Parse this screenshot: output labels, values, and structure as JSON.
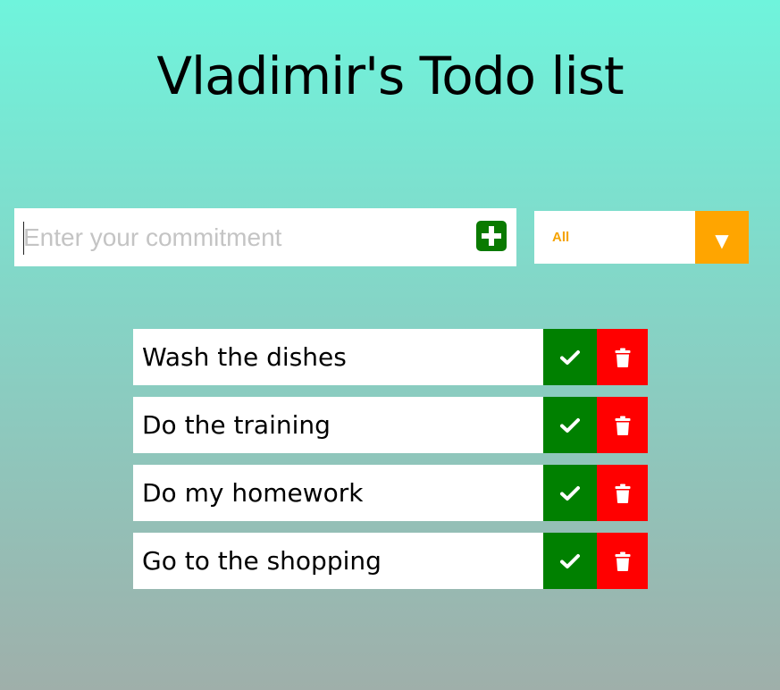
{
  "header": {
    "title": "Vladimir's Todo list"
  },
  "form": {
    "placeholder": "Enter your commitment",
    "value": "",
    "add_icon": "plus-square-icon",
    "filter": {
      "selected": "All",
      "arrow": "▼"
    }
  },
  "todos": [
    {
      "text": "Wash the dishes"
    },
    {
      "text": "Do the training"
    },
    {
      "text": "Do my homework"
    },
    {
      "text": "Go to the shopping"
    }
  ],
  "colors": {
    "complete": "#008000",
    "delete": "#ff0000",
    "filter_accent": "#ffa500",
    "add_button": "#0a7a00"
  },
  "icons": {
    "complete": "check-icon",
    "delete": "trash-icon"
  }
}
